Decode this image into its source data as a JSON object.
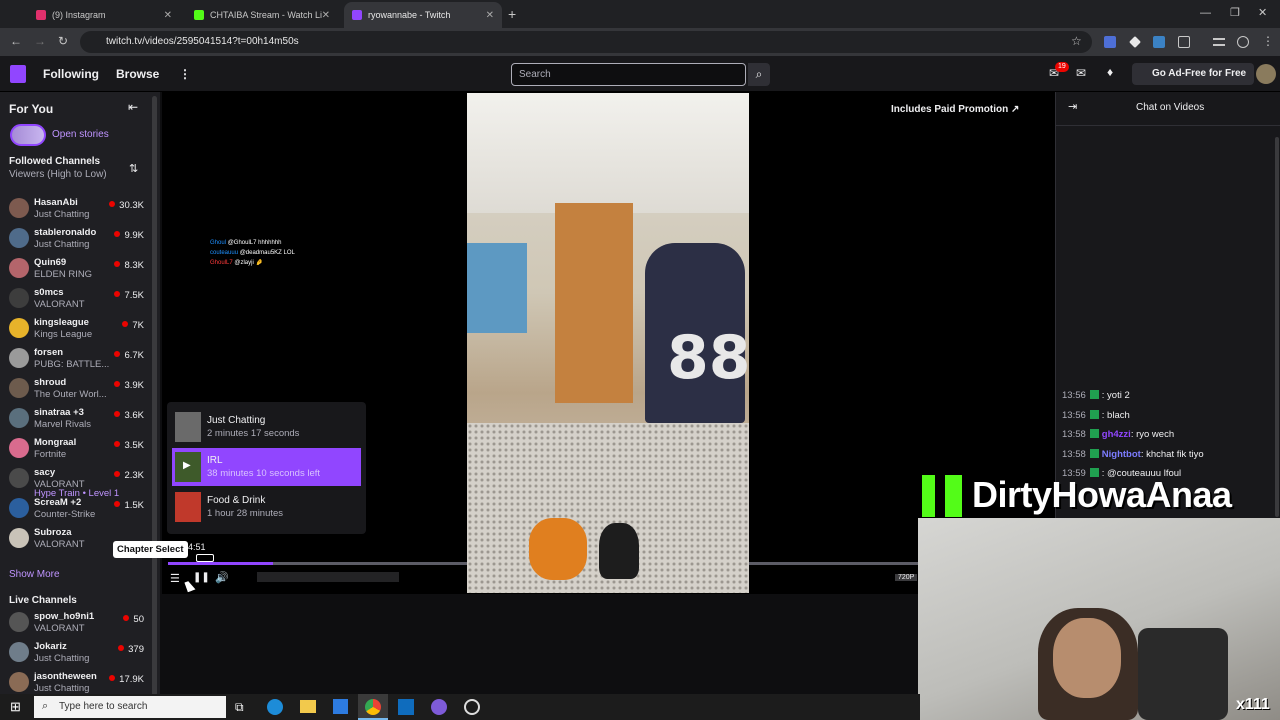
{
  "browser": {
    "tabs": [
      {
        "label": "(9) Instagram",
        "color": "#e1306c"
      },
      {
        "label": "CHTAIBA Stream - Watch Li",
        "color": "#53fc18"
      },
      {
        "label": "ryowannabe - Twitch",
        "color": "#9146ff"
      }
    ],
    "url": "twitch.tv/videos/2595041514?t=00h14m50s"
  },
  "topnav": {
    "following": "Following",
    "browse": "Browse",
    "search_placeholder": "Search",
    "notif_count": "19",
    "adfree": "Go Ad-Free for Free"
  },
  "sidebar": {
    "for_you": "For You",
    "open_stories": "Open stories",
    "followed_title": "Followed Channels",
    "followed_sort": "Viewers (High to Low)",
    "followed": [
      {
        "name": "HasanAbi",
        "game": "Just Chatting",
        "viewers": "30.3K",
        "color": "#7d5a4f"
      },
      {
        "name": "stableronaldo",
        "game": "Just Chatting",
        "viewers": "9.9K",
        "color": "#4f6b8a"
      },
      {
        "name": "Quin69",
        "game": "ELDEN RING",
        "viewers": "8.3K",
        "color": "#b4656b"
      },
      {
        "name": "s0mcs",
        "game": "VALORANT",
        "viewers": "7.5K",
        "color": "#3d3d3d"
      },
      {
        "name": "kingsleague",
        "game": "Kings League",
        "viewers": "7K",
        "color": "#e7b32a"
      },
      {
        "name": "forsen",
        "game": "PUBG: BATTLE...",
        "viewers": "6.7K",
        "color": "#9a9a9a"
      },
      {
        "name": "shroud",
        "game": "The Outer Worl...",
        "viewers": "3.9K",
        "color": "#6d5b4d"
      },
      {
        "name": "sinatraa +3",
        "game": "Marvel Rivals",
        "viewers": "3.6K",
        "color": "#5a6f7d"
      },
      {
        "name": "Mongraal",
        "game": "Fortnite",
        "viewers": "3.5K",
        "color": "#d96b8e"
      },
      {
        "name": "sacy",
        "game": "VALORANT",
        "viewers": "2.3K",
        "color": "#4a4a4a"
      },
      {
        "name": "ScreaM +2",
        "game": "Counter-Strike",
        "viewers": "1.5K",
        "color": "#2b5f9e"
      },
      {
        "name": "Subroza",
        "game": "VALORANT",
        "viewers": "",
        "color": "#c9c3b8"
      }
    ],
    "hype_train": "Hype Train • Level 1",
    "show_more": "Show More",
    "live_title": "Live Channels",
    "live": [
      {
        "name": "spow_ho9ni1",
        "game": "VALORANT",
        "viewers": "50",
        "color": "#555"
      },
      {
        "name": "Jokariz",
        "game": "Just Chatting",
        "viewers": "379",
        "color": "#6f7d8a"
      },
      {
        "name": "jasontheween",
        "game": "Just Chatting",
        "viewers": "17.9K",
        "color": "#8a6b55"
      }
    ]
  },
  "player": {
    "paid_promo": "Includes Paid Promotion",
    "overlay_chat": [
      {
        "user": "Ghoul",
        "text": "@GhoulL7 hhhhhhh"
      },
      {
        "user": "couteauuu",
        "text": "@deadmau5KZ LOL"
      },
      {
        "user": "GhoulL7",
        "text": "@zlayji 🤌"
      }
    ],
    "chapter_tooltip": "Chapter Select",
    "time": "4:51",
    "quality": "720P"
  },
  "chapters": [
    {
      "title": "Just Chatting",
      "sub": "2 minutes 17 seconds",
      "active": false
    },
    {
      "title": "IRL",
      "sub": "38 minutes 10 seconds left",
      "active": true
    },
    {
      "title": "Food & Drink",
      "sub": "1 hour 28 minutes",
      "active": false
    }
  ],
  "chat": {
    "title": "Chat on Videos",
    "messages": [
      {
        "time": "13:56",
        "user": "",
        "text": ": yoti 2",
        "color": "#1e22d6"
      },
      {
        "time": "13:56",
        "user": "",
        "text": ": blach",
        "color": "#ff2424"
      },
      {
        "time": "13:58",
        "user": "gh4zzi",
        "text": ": ryo wech",
        "color": "#9146ff"
      },
      {
        "time": "13:58",
        "user": "Nightbot",
        "text": ": khchat fik tiyo",
        "color": "#7c7cff"
      },
      {
        "time": "13:59",
        "user": "",
        "text": ": @couteauuu lfoul",
        "color": "#ff2424"
      }
    ]
  },
  "overlay_brand": "DirtyHowaAnaa",
  "overlay_corner": "x111",
  "taskbar": {
    "search": "Type here to search"
  },
  "colors": {
    "twitch_purple": "#9146ff",
    "live_red": "#eb0400"
  }
}
